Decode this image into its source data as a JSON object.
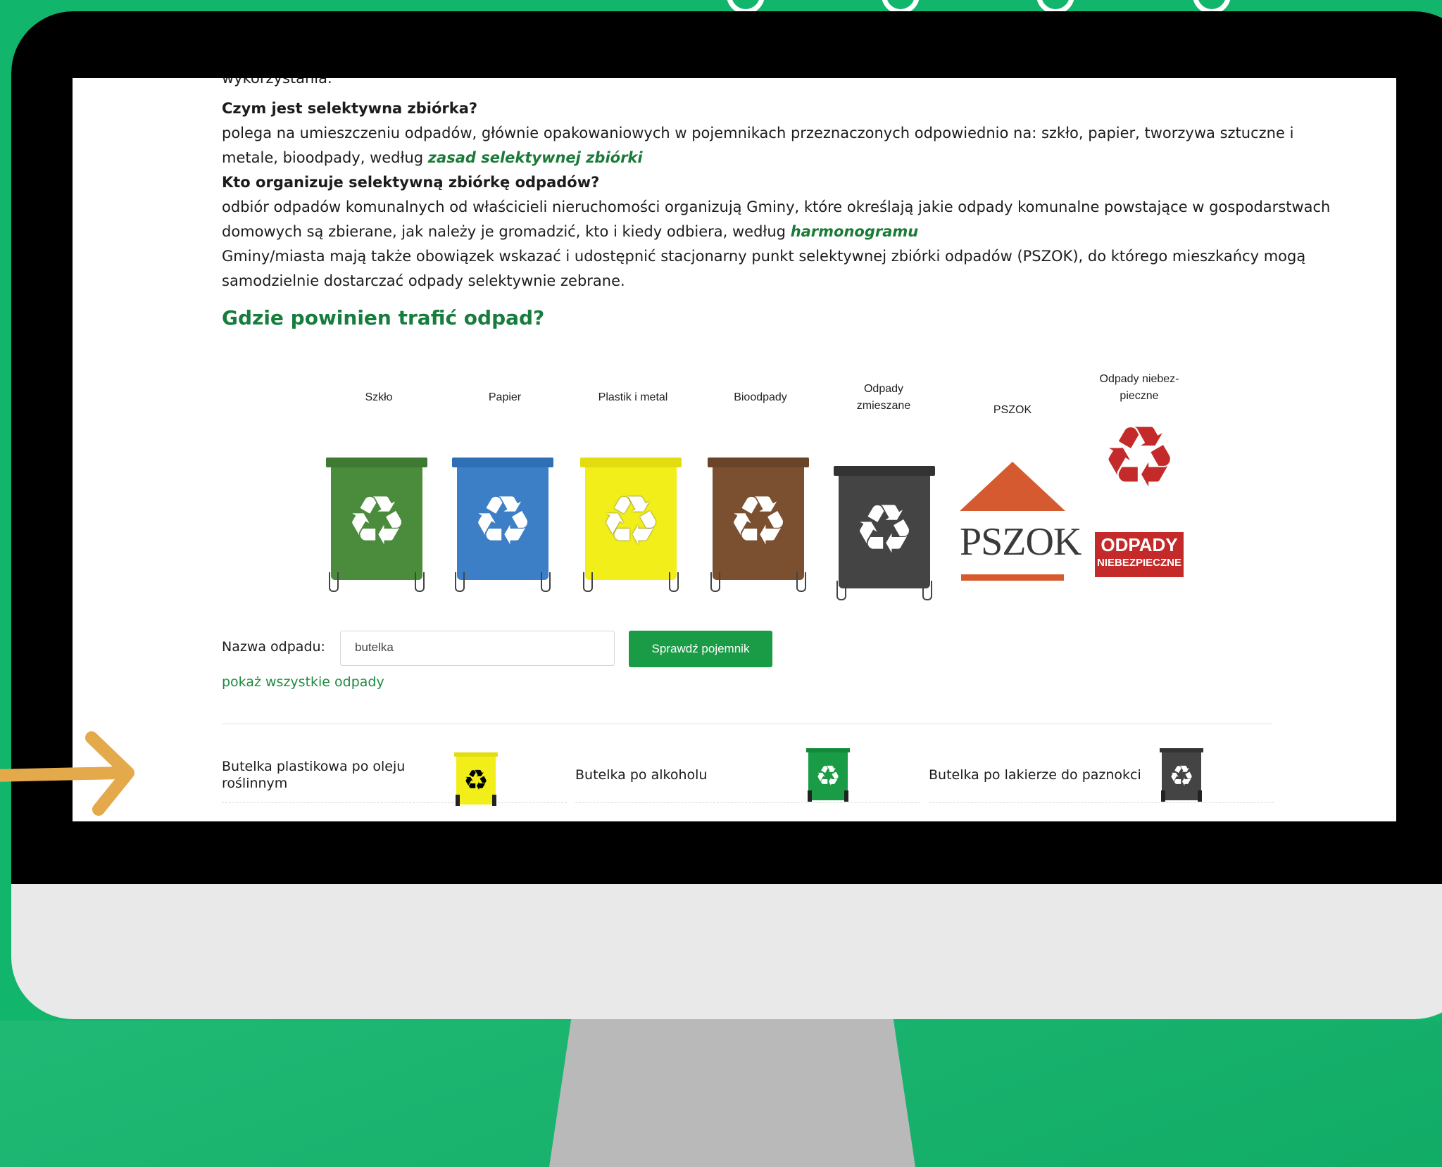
{
  "page": {
    "intro_fragment": "wykorzystania.",
    "q1": "Czym jest selektywna zbiórka?",
    "a1_text": "polega na umieszczeniu odpadów, głównie opakowaniowych w pojemnikach przeznaczonych odpowiednio na: szkło, papier, tworzywa sztuczne i metale, bioodpady, według ",
    "a1_link": "zasad selektywnej zbiórki",
    "q2": "Kto organizuje selektywną zbiórkę odpadów?",
    "a2_text": "odbiór odpadów komunalnych od właścicieli nieruchomości organizują Gminy, które określają jakie odpady komunalne powstające w gospodarstwach domowych są zbierane, jak należy je gromadzić, kto i kiedy odbiera, według ",
    "a2_link": "harmonogramu",
    "a3_text": "Gminy/miasta mają także obowiązek wskazać i udostępnić stacjonarny punkt selektywnej zbiórki odpadów (PSZOK), do którego mieszkańcy mogą samodzielnie dostarczać odpady selektywnie zebrane.",
    "heading": "Gdzie powinien trafić odpad?"
  },
  "bins": [
    {
      "label": "Szkło",
      "color": "#4a8b3c"
    },
    {
      "label": "Papier",
      "color": "#3d7fc7"
    },
    {
      "label": "Plastik i metal",
      "color": "#f2ee1a"
    },
    {
      "label": "Bioodpady",
      "color": "#7a5030"
    },
    {
      "label": "Odpady zmieszane",
      "color": "#444444"
    },
    {
      "label": "PSZOK",
      "sign_text": "PSZOK",
      "color": "#d65a2f"
    },
    {
      "label": "Odpady niebez-pieczne",
      "box_line1": "ODPADY",
      "box_line2": "NIEBEZPIECZNE",
      "color": "#c42a2a"
    }
  ],
  "search": {
    "label": "Nazwa odpadu:",
    "value": "butelka",
    "button_label": "Sprawdź pojemnik",
    "show_all": "pokaż wszystkie odpady"
  },
  "results": [
    {
      "name": "Butelka plastikowa po oleju roślinnym",
      "bin_color": "#f2ee1a",
      "icon": "yellow-bin-icon"
    },
    {
      "name": "Butelka po alkoholu",
      "bin_color": "#1a9b45",
      "icon": "green-bin-icon"
    },
    {
      "name": "Butelka po lakierze do paznokci",
      "bin_color": "#444444",
      "icon": "gray-bin-icon"
    }
  ],
  "theme": {
    "background": "#12b56c",
    "accent": "#1a9b45",
    "arrow": "#e3a94a"
  }
}
